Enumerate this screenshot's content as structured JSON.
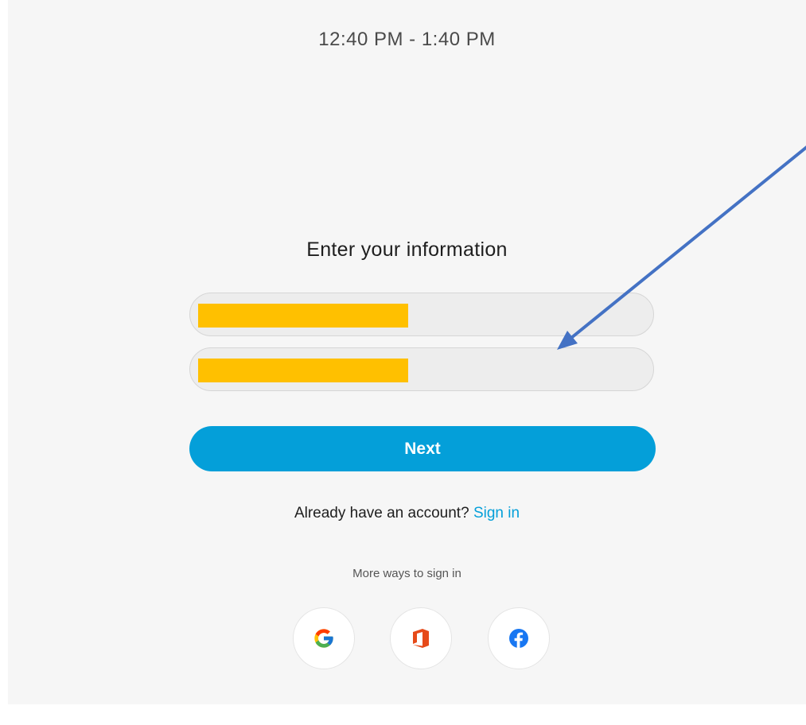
{
  "header": {
    "time_range": "12:40 PM - 1:40 PM"
  },
  "form": {
    "heading": "Enter your information",
    "field1": {
      "value": "",
      "placeholder": ""
    },
    "field2": {
      "value": "",
      "placeholder": ""
    },
    "next_label": "Next"
  },
  "account": {
    "prompt": "Already have an account?",
    "sign_in_label": "Sign in"
  },
  "alt_signin": {
    "label": "More ways to sign in",
    "providers": [
      {
        "name": "Google",
        "icon": "google-icon"
      },
      {
        "name": "Office",
        "icon": "office-icon"
      },
      {
        "name": "Facebook",
        "icon": "facebook-icon"
      }
    ]
  },
  "annotation": {
    "arrow_color": "#4472c4",
    "redaction_color": "#ffc000"
  },
  "colors": {
    "accent": "#049fd9",
    "background": "#f6f6f6",
    "field_background": "#ededed"
  }
}
